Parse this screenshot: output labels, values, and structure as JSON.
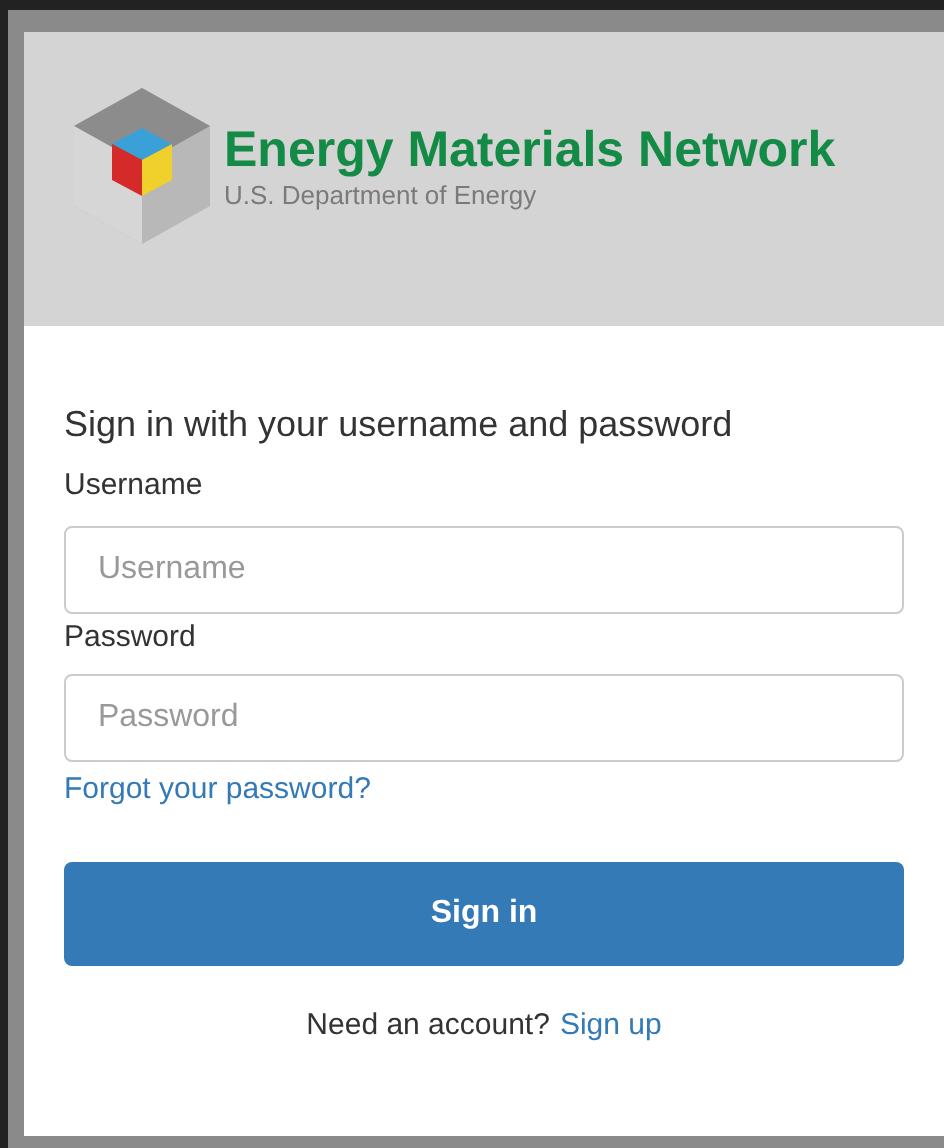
{
  "header": {
    "title": "Energy Materials Network",
    "subtitle": "U.S. Department of Energy"
  },
  "form": {
    "heading": "Sign in with your username and password",
    "fields": [
      {
        "label": "Username",
        "placeholder": "Username"
      },
      {
        "label": "Password",
        "placeholder": "Password"
      }
    ],
    "forgot_link": "Forgot your password?",
    "submit": "Sign in",
    "signup_prompt": "Need an account?",
    "signup_link": "Sign up"
  }
}
